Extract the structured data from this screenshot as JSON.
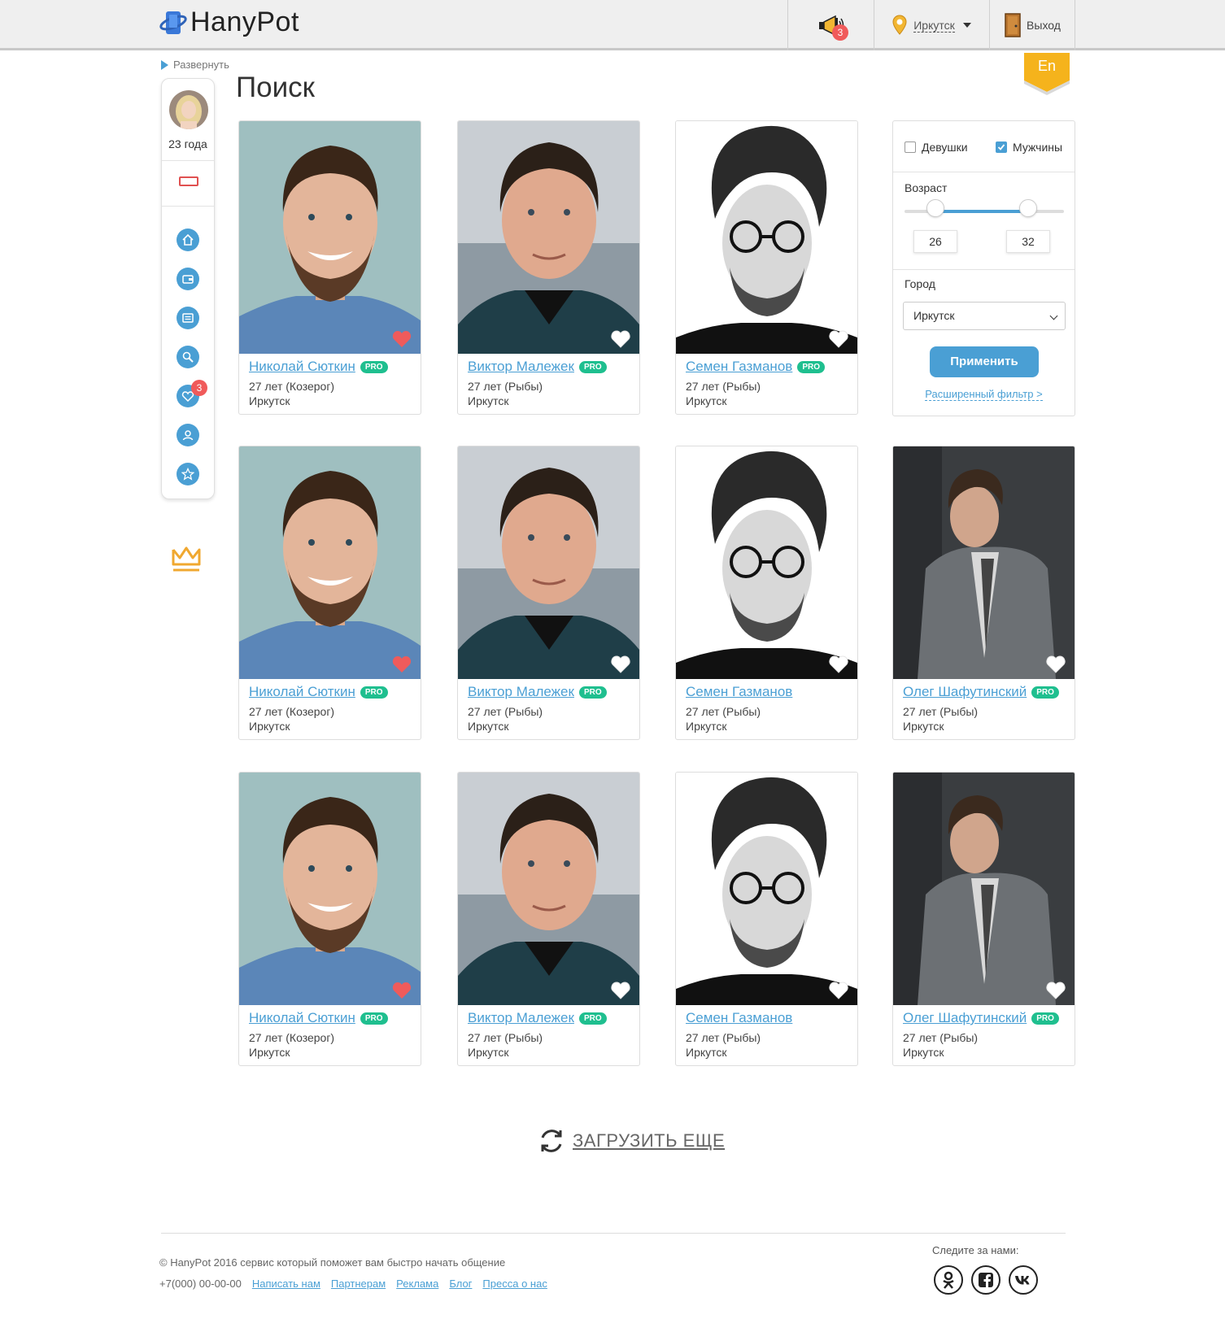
{
  "brand": {
    "name": "HanyPot"
  },
  "header": {
    "notifications_count": "3",
    "city": "Иркутск",
    "exit_label": "Выход"
  },
  "nav": {
    "expand_label": "Развернуть"
  },
  "lang": {
    "label": "En"
  },
  "page": {
    "title": "Поиск"
  },
  "sidebar": {
    "age": "23 года",
    "items": [
      {
        "icon": "home-icon"
      },
      {
        "icon": "wallet-icon"
      },
      {
        "icon": "messages-icon"
      },
      {
        "icon": "search-icon"
      },
      {
        "icon": "likes-icon",
        "badge": "3"
      },
      {
        "icon": "profile-icon"
      },
      {
        "icon": "star-icon"
      }
    ]
  },
  "cards": [
    {
      "name": "Николай Сюткин",
      "pro": "PRO",
      "age": "27 лет (Козерог)",
      "city": "Иркутск",
      "liked": true,
      "photo": "p1"
    },
    {
      "name": "Виктор Малежек",
      "pro": "PRO",
      "age": "27 лет (Рыбы)",
      "city": "Иркутск",
      "liked": false,
      "photo": "p2"
    },
    {
      "name": "Семен Газманов",
      "pro": "PRO",
      "age": "27 лет (Рыбы)",
      "city": "Иркутск",
      "liked": false,
      "photo": "p3"
    },
    {
      "name": "Николай Сюткин",
      "pro": "PRO",
      "age": "27 лет (Козерог)",
      "city": "Иркутск",
      "liked": true,
      "photo": "p1"
    },
    {
      "name": "Виктор Малежек",
      "pro": "PRO",
      "age": "27 лет (Рыбы)",
      "city": "Иркутск",
      "liked": false,
      "photo": "p2"
    },
    {
      "name": "Семен Газманов",
      "pro": "",
      "age": "27 лет (Рыбы)",
      "city": "Иркутск",
      "liked": false,
      "photo": "p3"
    },
    {
      "name": "Олег Шафутинский",
      "pro": "PRO",
      "age": "27 лет (Рыбы)",
      "city": "Иркутск",
      "liked": false,
      "photo": "p4"
    },
    {
      "name": "Николай Сюткин",
      "pro": "PRO",
      "age": "27 лет (Козерог)",
      "city": "Иркутск",
      "liked": true,
      "photo": "p1"
    },
    {
      "name": "Виктор Малежек",
      "pro": "PRO",
      "age": "27 лет (Рыбы)",
      "city": "Иркутск",
      "liked": false,
      "photo": "p2"
    },
    {
      "name": "Семен Газманов",
      "pro": "",
      "age": "27 лет (Рыбы)",
      "city": "Иркутск",
      "liked": false,
      "photo": "p3"
    },
    {
      "name": "Олег Шафутинский",
      "pro": "PRO",
      "age": "27 лет (Рыбы)",
      "city": "Иркутск",
      "liked": false,
      "photo": "p4"
    }
  ],
  "filter": {
    "girls_label": "Девушки",
    "girls_checked": false,
    "men_label": "Мужчины",
    "men_checked": true,
    "age_label": "Возраст",
    "age_min": "26",
    "age_max": "32",
    "city_label": "Город",
    "city_value": "Иркутск",
    "apply_label": "Применить",
    "advanced_label": "Расширенный фильтр >"
  },
  "load_more": {
    "label": "ЗАГРУЗИТЬ ЕЩЕ"
  },
  "footer": {
    "copyright": "© HanyPot 2016 сервис который поможет вам быстро начать общение",
    "phone": "+7(000) 00-00-00",
    "links": [
      "Написать нам",
      "Партнерам",
      "Реклама",
      "Блог",
      "Пресса о нас"
    ],
    "follow_label": "Следите за нами:",
    "social": [
      "odnoklassniki-icon",
      "facebook-icon",
      "vk-icon"
    ]
  },
  "colors": {
    "accent": "#4a9fd4",
    "pro": "#1fbf8f",
    "badge": "#f05a5a",
    "heart_liked": "#ef5b5b",
    "crown": "#f0a830"
  }
}
